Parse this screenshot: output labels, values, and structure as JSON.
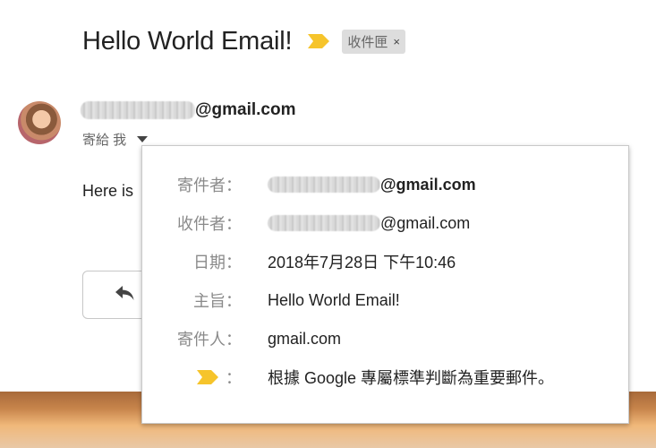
{
  "subject": {
    "title": "Hello World Email!",
    "label_chip": "收件匣",
    "label_close": "×"
  },
  "sender": {
    "email_suffix": "@gmail.com"
  },
  "recipient_line": {
    "text": "寄給 我"
  },
  "body": {
    "preview": "Here is"
  },
  "details": {
    "from_label": "寄件者：",
    "from_value_suffix": "@gmail.com",
    "to_label": "收件者：",
    "to_value_suffix": "@gmail.com",
    "date_label": "日期：",
    "date_value": "2018年7月28日 下午10:46",
    "subject_label": "主旨：",
    "subject_value": "Hello World Email!",
    "mailed_by_label": "寄件人：",
    "mailed_by_value": "gmail.com",
    "importance_label_suffix": "：",
    "importance_value": "根據 Google 專屬標準判斷為重要郵件。"
  },
  "colors": {
    "importance_marker": "#f6c42b",
    "chip_bg": "#dddddd",
    "muted_text": "#8a8a8a"
  },
  "icons": {
    "importance": "importance-marker-icon",
    "reply": "reply-arrow-icon",
    "dropdown": "caret-down-icon"
  }
}
